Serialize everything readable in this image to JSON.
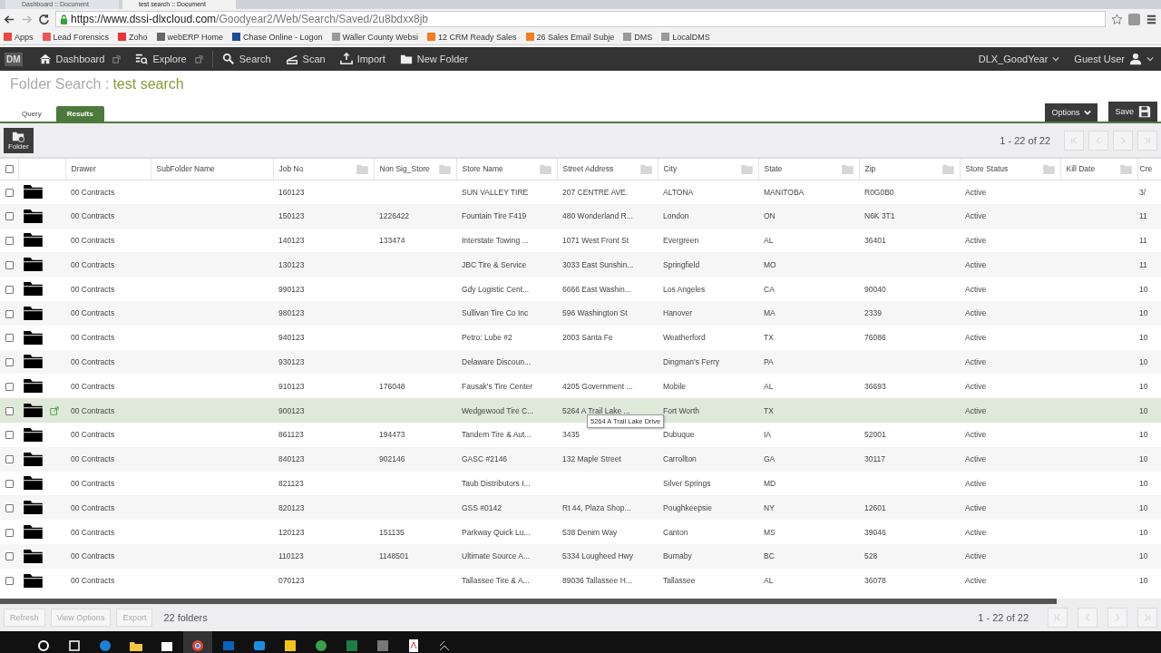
{
  "browser": {
    "tabs": [
      {
        "label": "Dashboard :: Document",
        "selected": false
      },
      {
        "label": "test search :: Document",
        "selected": true
      }
    ],
    "url_host": "https://www.dssi-dlxcloud.com",
    "url_path": "/Goodyear2/Web/Search/Saved/2u8bdxx8jb",
    "bookmarks": [
      "Apps",
      "Lead Forensics",
      "Zoho",
      "webERP Home",
      "Chase Online - Logon",
      "Waller County Websi",
      "12 CRM Ready Sales",
      "26 Sales Email Subje",
      "DMS",
      "LocalDMS"
    ]
  },
  "logo": "DM",
  "nav": [
    {
      "label": "Dashboard",
      "external": true
    },
    {
      "label": "Explore",
      "external": true
    },
    {
      "label": "Search",
      "external": false
    },
    {
      "label": "Scan",
      "external": false
    },
    {
      "label": "Import",
      "external": false
    },
    {
      "label": "New Folder",
      "external": false
    }
  ],
  "account": "DLX_GoodYear",
  "user": "Guest User",
  "title": {
    "prefix": "Folder Search :",
    "name": "test search"
  },
  "view_tabs": [
    {
      "label": "Query",
      "selected": false
    },
    {
      "label": "Results",
      "selected": true
    }
  ],
  "options_button": "Options",
  "save_button": "Save",
  "folder_button": "Folder",
  "range": "1 - 22 of 22",
  "table": {
    "select_all_checked": false,
    "columns": [
      "Drawer",
      "SubFolder Name",
      "Job No",
      "Non Sig_Store",
      "Store Name",
      "Street Address",
      "City",
      "State",
      "Zip",
      "Store Status",
      "Kill Date",
      "Cre"
    ],
    "rows": [
      {
        "selected": false,
        "cells": [
          "00 Contracts",
          "",
          "160123",
          "",
          "SUN VALLEY TIRE",
          "207 CENTRE AVE.",
          "ALTONA",
          "MANITOBA",
          "R0G0B0",
          "Active",
          "",
          "3/"
        ]
      },
      {
        "selected": false,
        "cells": [
          "00 Contracts",
          "",
          "150123",
          "1226422",
          "Fountain Tire F419",
          "480 Wonderland R...",
          "London",
          "ON",
          "N6K 3T1",
          "Active",
          "",
          "11"
        ]
      },
      {
        "selected": false,
        "cells": [
          "00 Contracts",
          "",
          "140123",
          "133474",
          "Interstate Towing ...",
          "1071 West Front St",
          "Evergreen",
          "AL",
          "36401",
          "Active",
          "",
          "11"
        ]
      },
      {
        "selected": false,
        "cells": [
          "00 Contracts",
          "",
          "130123",
          "",
          "JBC Tire & Service",
          "3033 East Sunshin...",
          "Springfield",
          "MO",
          "",
          "Active",
          "",
          "11"
        ]
      },
      {
        "selected": false,
        "cells": [
          "00 Contracts",
          "",
          "990123",
          "",
          "Gdy Logistic Cent...",
          "6666 East Washin...",
          "Los Angeles",
          "CA",
          "90040",
          "Active",
          "",
          "10"
        ]
      },
      {
        "selected": false,
        "cells": [
          "00 Contracts",
          "",
          "980123",
          "",
          "Sullivan Tire Co Inc",
          "596 Washington St",
          "Hanover",
          "MA",
          "2339",
          "Active",
          "",
          "10"
        ]
      },
      {
        "selected": false,
        "cells": [
          "00 Contracts",
          "",
          "940123",
          "",
          "Petro: Lube #2",
          "2003 Santa Fe",
          "Weatherford",
          "TX",
          "76086",
          "Active",
          "",
          "10"
        ]
      },
      {
        "selected": false,
        "cells": [
          "00 Contracts",
          "",
          "930123",
          "",
          "Delaware Discoun...",
          "",
          "Dingman's Ferry",
          "PA",
          "",
          "Active",
          "",
          "10"
        ]
      },
      {
        "selected": false,
        "cells": [
          "00 Contracts",
          "",
          "910123",
          "176048",
          "Fausak's Tire Center",
          "4205 Government ...",
          "Mobile",
          "AL",
          "36693",
          "Active",
          "",
          "10"
        ]
      },
      {
        "selected": true,
        "cells": [
          "00 Contracts",
          "",
          "900123",
          "",
          "Wedgewood Tire C...",
          "5264 A Trail Lake ...",
          "Fort Worth",
          "TX",
          "",
          "Active",
          "",
          "10"
        ]
      },
      {
        "selected": false,
        "cells": [
          "00 Contracts",
          "",
          "861123",
          "194473",
          "Tandem Tire & Aut...",
          "3435",
          "Dubuque",
          "IA",
          "52001",
          "Active",
          "",
          "10"
        ]
      },
      {
        "selected": false,
        "cells": [
          "00 Contracts",
          "",
          "840123",
          "902146",
          "GASC #2146",
          "132 Maple Street",
          "Carrollton",
          "GA",
          "30117",
          "Active",
          "",
          "10"
        ]
      },
      {
        "selected": false,
        "cells": [
          "00 Contracts",
          "",
          "821123",
          "",
          "Taub Distributors I...",
          "",
          "Silver Springs",
          "MD",
          "",
          "Active",
          "",
          "10"
        ]
      },
      {
        "selected": false,
        "cells": [
          "00 Contracts",
          "",
          "820123",
          "",
          "GSS #0142",
          "Rt 44, Plaza Shop...",
          "Poughkeepsie",
          "NY",
          "12601",
          "Active",
          "",
          "10"
        ]
      },
      {
        "selected": false,
        "cells": [
          "00 Contracts",
          "",
          "120123",
          "151135",
          "Parkway Quick Lu...",
          "538 Denim Way",
          "Canton",
          "MS",
          "39046",
          "Active",
          "",
          "10"
        ]
      },
      {
        "selected": false,
        "cells": [
          "00 Contracts",
          "",
          "110123",
          "1148501",
          "Ultimate Source A...",
          "5334 Lougheed Hwy",
          "Burnaby",
          "BC",
          "528",
          "Active",
          "",
          "10"
        ]
      },
      {
        "selected": false,
        "cells": [
          "00 Contracts",
          "",
          "070123",
          "",
          "Tallassee Tire & A...",
          "89036 Tallassee H...",
          "Tallassee",
          "AL",
          "36078",
          "Active",
          "",
          "10"
        ]
      }
    ]
  },
  "tooltip": "5264 A Trail Lake Drive",
  "footer_buttons": [
    "Refresh",
    "View Options",
    "Export"
  ],
  "footer_count": "22 folders",
  "footer_range": "1 - 22 of 22"
}
